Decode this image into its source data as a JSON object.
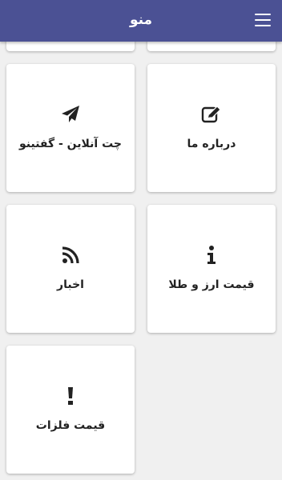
{
  "header": {
    "title": "منو",
    "menu_icon": "hamburger-menu-icon"
  },
  "theme": {
    "appbar_color": "#4b5194",
    "icon_color": "#222222",
    "card_color": "#ffffff",
    "background": "#f0f0f0"
  },
  "menu": {
    "items": [
      {
        "label": "درباره ما",
        "icon": "edit-icon"
      },
      {
        "label": "چت آنلاین - گفتینو",
        "icon": "paper-plane-icon"
      },
      {
        "label": "قیمت ارز و طلا",
        "icon": "info-icon"
      },
      {
        "label": "اخبار",
        "icon": "rss-icon"
      },
      {
        "label": "قیمت فلزات",
        "icon": "exclamation-icon"
      }
    ]
  }
}
